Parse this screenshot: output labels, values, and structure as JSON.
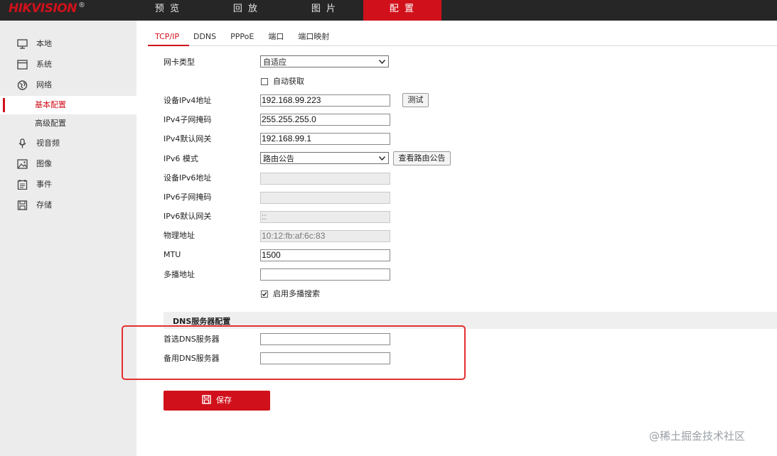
{
  "brand": {
    "logo": "HIKVISION",
    "reg_mark": "®",
    "accent": "#d0111b"
  },
  "topnav": [
    {
      "label": "预 览",
      "active": false
    },
    {
      "label": "回 放",
      "active": false
    },
    {
      "label": "图 片",
      "active": false
    },
    {
      "label": "配 置",
      "active": true
    }
  ],
  "sidebar": {
    "items": [
      {
        "label": "本地",
        "icon": "monitor-icon"
      },
      {
        "label": "系统",
        "icon": "system-icon"
      },
      {
        "label": "网络",
        "icon": "globe-icon"
      },
      {
        "label": "视音频",
        "icon": "microphone-icon"
      },
      {
        "label": "图像",
        "icon": "image-icon"
      },
      {
        "label": "事件",
        "icon": "event-icon"
      },
      {
        "label": "存储",
        "icon": "save-disk-icon"
      }
    ],
    "network_sub": [
      {
        "label": "基本配置",
        "active": true
      },
      {
        "label": "高级配置",
        "active": false
      }
    ]
  },
  "tabs": [
    {
      "label": "TCP/IP",
      "active": true
    },
    {
      "label": "DDNS",
      "active": false
    },
    {
      "label": "PPPoE",
      "active": false
    },
    {
      "label": "端口",
      "active": false
    },
    {
      "label": "端口映射",
      "active": false
    }
  ],
  "form": {
    "nic_type_label": "网卡类型",
    "nic_type_value": "自适应",
    "dhcp_label": "自动获取",
    "dhcp_checked": false,
    "ipv4_addr_label": "设备IPv4地址",
    "ipv4_addr_value": "192.168.99.223",
    "test_button": "测试",
    "ipv4_mask_label": "IPv4子网掩码",
    "ipv4_mask_value": "255.255.255.0",
    "ipv4_gw_label": "IPv4默认网关",
    "ipv4_gw_value": "192.168.99.1",
    "ipv6_mode_label": "IPv6 模式",
    "ipv6_mode_value": "路由公告",
    "view_ra_button": "查看路由公告",
    "ipv6_addr_label": "设备IPv6地址",
    "ipv6_addr_value": "",
    "ipv6_mask_label": "IPv6子网掩码",
    "ipv6_mask_value": "",
    "ipv6_gw_label": "IPv6默认网关",
    "ipv6_gw_value": "::",
    "mac_label": "物理地址",
    "mac_value": "10:12:fb:af:6c:83",
    "mtu_label": "MTU",
    "mtu_value": "1500",
    "multicast_label": "多播地址",
    "multicast_value": "",
    "multicast_search_label": "启用多播搜索",
    "multicast_search_checked": true
  },
  "dns": {
    "section_title": "DNS服务器配置",
    "primary_label": "首选DNS服务器",
    "primary_value": "",
    "secondary_label": "备用DNS服务器",
    "secondary_value": ""
  },
  "save_button": "保存",
  "watermark": "@稀土掘金技术社区"
}
